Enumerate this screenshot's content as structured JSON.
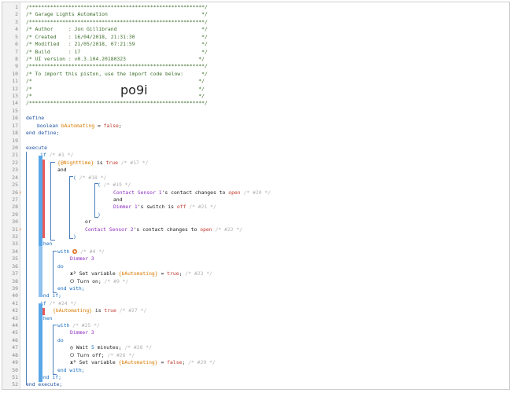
{
  "editor": {
    "line_numbers": [
      "1",
      "2",
      "3",
      "4",
      "5",
      "6",
      "7",
      "8",
      "9",
      "10",
      "11",
      "12",
      "13",
      "14",
      "15",
      "16",
      "17",
      "18",
      "19",
      "20",
      "21",
      "22",
      "23",
      "24",
      "25",
      "26",
      "27",
      "28",
      "29",
      "30",
      "31",
      "32",
      "33",
      "34",
      "35",
      "36",
      "37",
      "38",
      "39",
      "40",
      "41",
      "42",
      "43",
      "44",
      "45",
      "46",
      "47",
      "48",
      "49",
      "50",
      "51",
      "52"
    ],
    "header": {
      "stars_top": "/**********************************************************/",
      "title": "/* Garage Lights Automation                               */",
      "stars_2": "/**********************************************************/",
      "author": "/* Author     : Jon Gillibrand                            */",
      "created": "/* Created    : 16/04/2018, 21:31:30                      */",
      "modified": "/* Modified   : 21/05/2018, 07:21:59                      */",
      "build": "/* Build      : 17                                        */",
      "ui_version": "/* UI version : v0.3.104.20180323                        */",
      "stars_3": "/**********************************************************/",
      "import_hint": "/* To import this piston, use the import code below:      */",
      "blank_1": "/*                                                       */",
      "blank_2": "/*                                                       */",
      "blank_3": "/*                                                       */",
      "import_code": "po9i",
      "stars_bottom": "/**********************************************************/"
    },
    "define": {
      "kw": "define",
      "type": "boolean",
      "var": "bAutomating",
      "assign": " = ",
      "value": "false",
      "semi": ";",
      "end": "end define;"
    },
    "execute": {
      "kw": "execute",
      "end": "end execute;"
    },
    "lines": {
      "if1": "if",
      "if1_c": "/* #1 */",
      "nighttime": "{@Nighttime}",
      "is_true": " is ",
      "true_word": "true",
      "c17": "/* #17 */",
      "and1": "and",
      "paren_open_18": "(",
      "c18": "/* #18 */",
      "paren_open_19": "(",
      "c19": "/* #19 */",
      "contact1_dev": "Contact Sensor 1",
      "contact1_rest": "'s contact changes to ",
      "open": "open",
      "c20": "/* #20 */",
      "and2": "and",
      "dimmer1_dev": "Dimmer 1",
      "dimmer1_rest": "'s switch is ",
      "off": "off",
      "c21": "/* #21 */",
      "paren_close_19": ")",
      "or": "or",
      "contact2_dev": "Contact Sensor 2",
      "contact2_rest": "'s contact changes to ",
      "c22": "/* #22 */",
      "paren_close_18": ")",
      "then1": "then",
      "with1": "with",
      "c4": "/* #4 */",
      "dimmer3_a": "Dimmer 3",
      "do1": "do",
      "setvar1_a": "Set variable ",
      "setvar_var": "{bAutomating}",
      "setvar1_b": " = ",
      "setvar1_true": "true",
      "c23": "/* #23 */",
      "turnon": "Turn on;",
      "c9": "/* #9 */",
      "endwith1": "end with;",
      "endif1": "end if;",
      "if2": "if",
      "c24": "/* #24 */",
      "bauto_cond": "{bAutomating}",
      "c27": "/* #27 */",
      "then2": "then",
      "with2": "with",
      "c25": "/* #25 */",
      "dimmer3_b": "Dimmer 3",
      "do2": "do",
      "wait_a": "Wait ",
      "wait_n": "5",
      "wait_b": " minutes;",
      "c28": "/* #28 */",
      "turnoff": "Turn off;",
      "c26": "/* #26 */",
      "setvar2_false": "false",
      "c29": "/* #29 */",
      "endwith2": "end with;",
      "endif2": "end if;"
    },
    "marks": {
      "line26": "⚡",
      "line31": "⚡"
    }
  },
  "colors": {
    "comment": "#3c6e2a",
    "keyword": "#1a4e9e",
    "variable": "#d97a00",
    "device": "#8e2fc0",
    "value": "#c0392b",
    "bracket": "#4a7fbf",
    "trigger_bar": "#e85a5a",
    "condition_bar": "#5aa7e8"
  }
}
